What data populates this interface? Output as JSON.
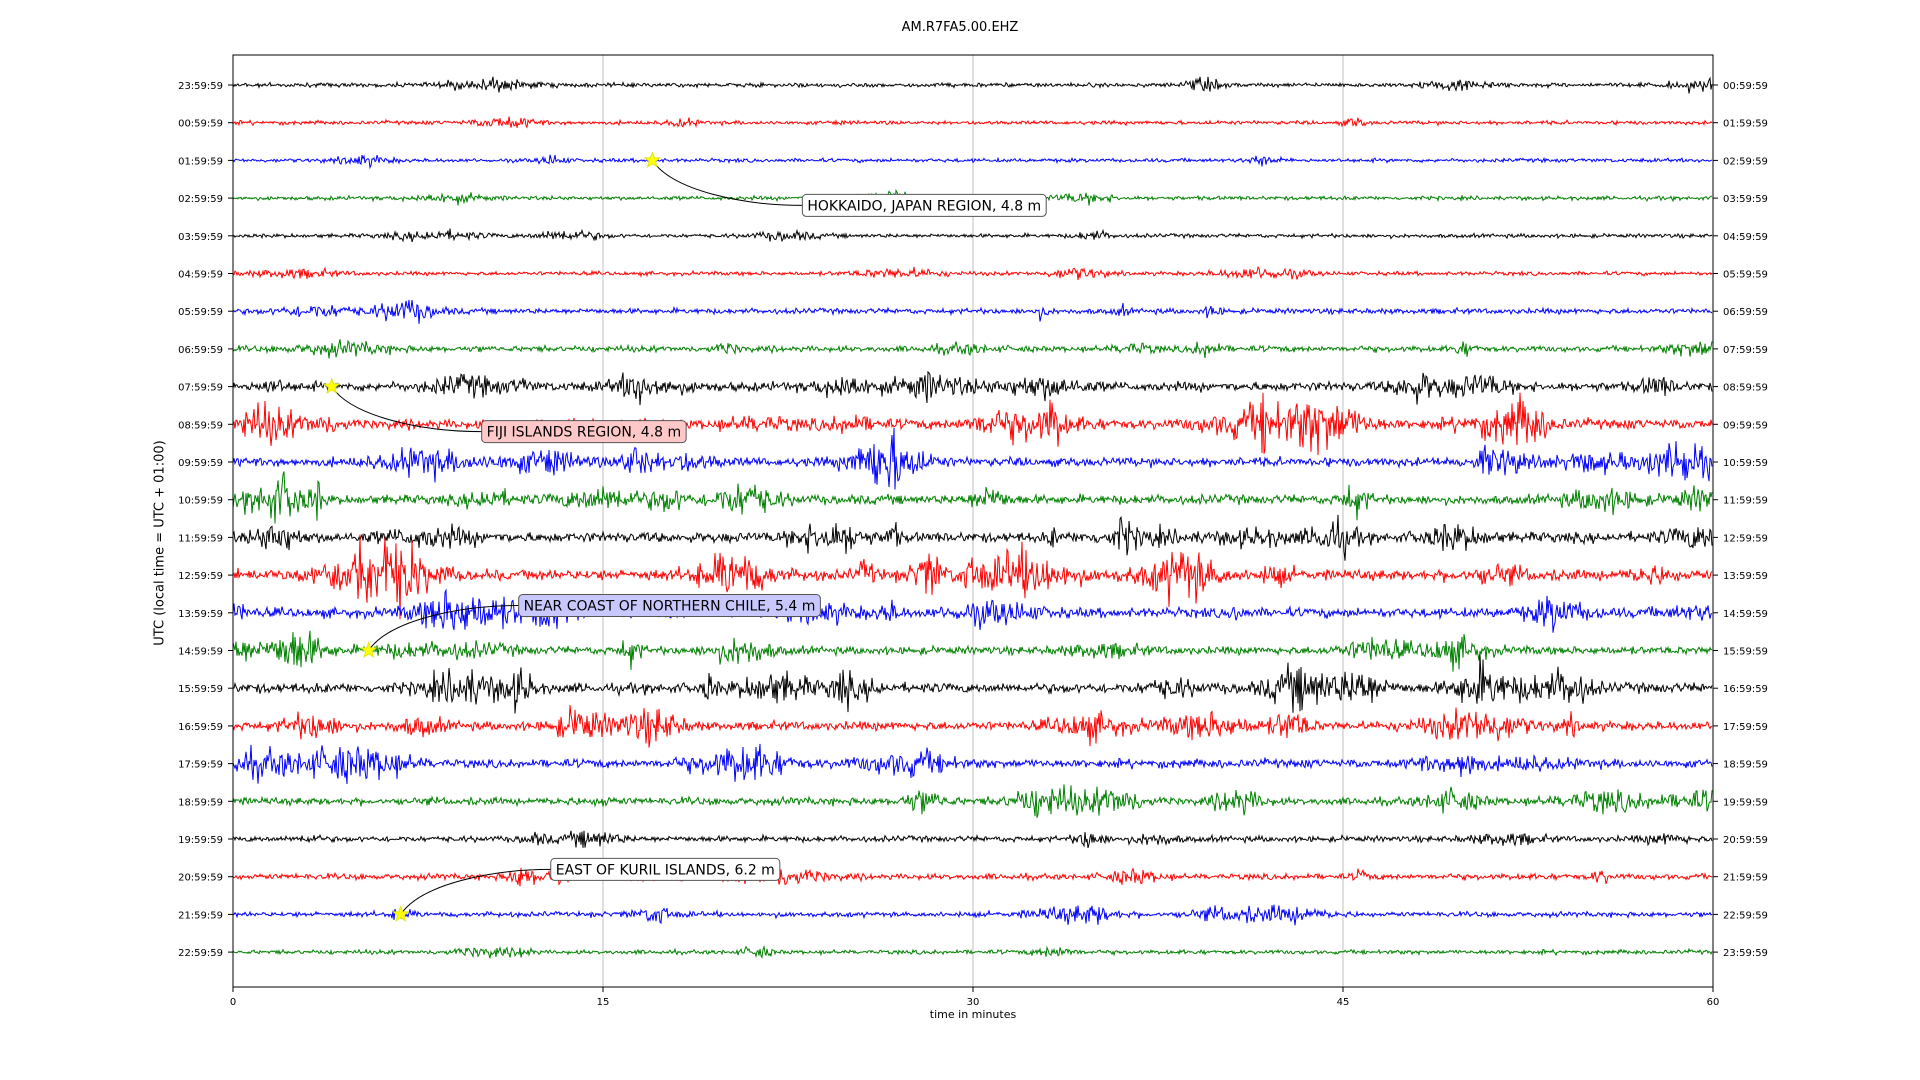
{
  "chart_data": {
    "type": "line",
    "title": "AM.R7FA5.00.EHZ",
    "xlabel": "time in minutes",
    "ylabel": "UTC (local time = UTC + 01:00)",
    "xlim": [
      0,
      60
    ],
    "x_ticks": [
      0,
      15,
      30,
      45,
      60
    ],
    "grid": "vertical",
    "colors": [
      "#000000",
      "#ff0000",
      "#0000ff",
      "#008000"
    ],
    "rows": [
      {
        "left": "23:59:59",
        "right": "00:59:59",
        "color": "#000000",
        "activity": 0.15
      },
      {
        "left": "00:59:59",
        "right": "01:59:59",
        "color": "#ff0000",
        "activity": 0.1
      },
      {
        "left": "01:59:59",
        "right": "02:59:59",
        "color": "#0000ff",
        "activity": 0.1
      },
      {
        "left": "02:59:59",
        "right": "03:59:59",
        "color": "#008000",
        "activity": 0.12
      },
      {
        "left": "03:59:59",
        "right": "04:59:59",
        "color": "#000000",
        "activity": 0.12
      },
      {
        "left": "04:59:59",
        "right": "05:59:59",
        "color": "#ff0000",
        "activity": 0.12
      },
      {
        "left": "05:59:59",
        "right": "06:59:59",
        "color": "#0000ff",
        "activity": 0.3
      },
      {
        "left": "06:59:59",
        "right": "07:59:59",
        "color": "#008000",
        "activity": 0.35
      },
      {
        "left": "07:59:59",
        "right": "08:59:59",
        "color": "#000000",
        "activity": 0.75
      },
      {
        "left": "08:59:59",
        "right": "09:59:59",
        "color": "#ff0000",
        "activity": 0.8
      },
      {
        "left": "09:59:59",
        "right": "10:59:59",
        "color": "#0000ff",
        "activity": 0.7
      },
      {
        "left": "10:59:59",
        "right": "11:59:59",
        "color": "#008000",
        "activity": 0.75
      },
      {
        "left": "11:59:59",
        "right": "12:59:59",
        "color": "#000000",
        "activity": 0.85
      },
      {
        "left": "12:59:59",
        "right": "13:59:59",
        "color": "#ff0000",
        "activity": 0.95
      },
      {
        "left": "13:59:59",
        "right": "14:59:59",
        "color": "#0000ff",
        "activity": 0.8
      },
      {
        "left": "14:59:59",
        "right": "15:59:59",
        "color": "#008000",
        "activity": 0.6
      },
      {
        "left": "15:59:59",
        "right": "16:59:59",
        "color": "#000000",
        "activity": 0.85
      },
      {
        "left": "16:59:59",
        "right": "17:59:59",
        "color": "#ff0000",
        "activity": 0.7
      },
      {
        "left": "17:59:59",
        "right": "18:59:59",
        "color": "#0000ff",
        "activity": 0.65
      },
      {
        "left": "18:59:59",
        "right": "19:59:59",
        "color": "#008000",
        "activity": 0.55
      },
      {
        "left": "19:59:59",
        "right": "20:59:59",
        "color": "#000000",
        "activity": 0.35
      },
      {
        "left": "20:59:59",
        "right": "21:59:59",
        "color": "#ff0000",
        "activity": 0.35
      },
      {
        "left": "21:59:59",
        "right": "22:59:59",
        "color": "#0000ff",
        "activity": 0.25
      },
      {
        "left": "22:59:59",
        "right": "23:59:59",
        "color": "#008000",
        "activity": 0.15
      }
    ],
    "events": [
      {
        "label": "HOKKAIDO, JAPAN REGION, 4.8 m",
        "row": 2,
        "minute": 17.0,
        "box_color": "#ffffff",
        "label_side": "below-right"
      },
      {
        "label": "FIJI ISLANDS REGION, 4.8 m",
        "row": 8,
        "minute": 4.0,
        "box_color": "#ffc8c8",
        "label_side": "below-right"
      },
      {
        "label": "NEAR COAST OF NORTHERN CHILE, 5.4 m",
        "row": 15,
        "minute": 5.5,
        "box_color": "#c8c8ff",
        "label_side": "above-right"
      },
      {
        "label": "EAST OF KURIL ISLANDS, 6.2 m",
        "row": 22,
        "minute": 6.8,
        "box_color": "#ffffff",
        "label_side": "above-right"
      }
    ]
  }
}
